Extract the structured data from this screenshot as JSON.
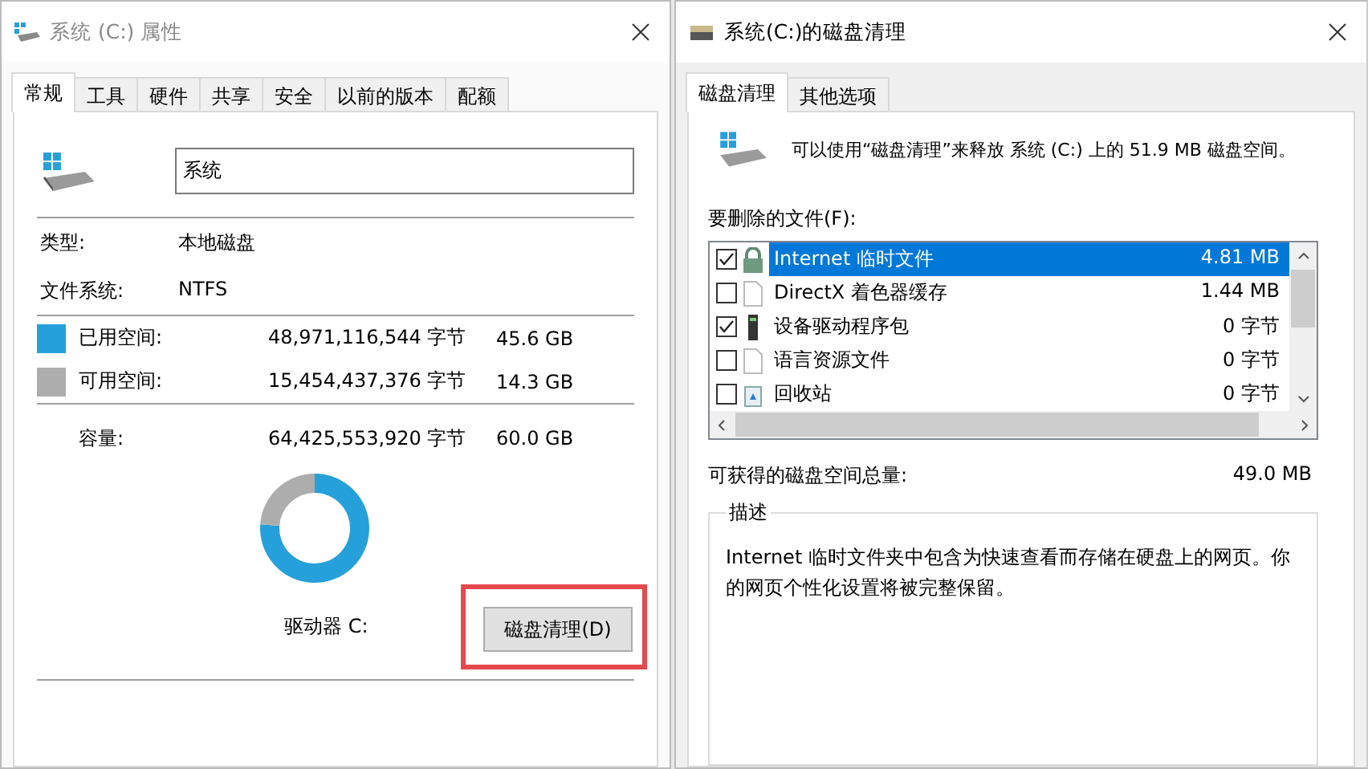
{
  "left_window": {
    "title": "系统 (C:) 属性",
    "active": false,
    "tabs": [
      {
        "label": "常规",
        "selected": true
      },
      {
        "label": "工具",
        "selected": false
      },
      {
        "label": "硬件",
        "selected": false
      },
      {
        "label": "共享",
        "selected": false
      },
      {
        "label": "安全",
        "selected": false
      },
      {
        "label": "以前的版本",
        "selected": false
      },
      {
        "label": "配额",
        "selected": false
      }
    ],
    "name_field": {
      "value": "系统"
    },
    "properties": [
      {
        "label": "类型:",
        "value": "本地磁盘"
      },
      {
        "label": "文件系统:",
        "value": "NTFS"
      }
    ],
    "space_rows": [
      {
        "label": "已用空间:",
        "bytes": "48,971,116,544 字节",
        "size": "45.6 GB",
        "color": "#26a0da"
      },
      {
        "label": "可用空间:",
        "bytes": "15,454,437,376 字节",
        "size": "14.3 GB",
        "color": "#adadad"
      }
    ],
    "capacity": {
      "label": "容量:",
      "bytes": "64,425,553,920 字节",
      "size": "60.0 GB"
    },
    "chart_data": {
      "type": "donut",
      "values": [
        76.1,
        23.9
      ]
    },
    "drive_label": "驱动器 C:",
    "cleanup_button": {
      "label": "磁盘清理(D)",
      "highlighted": true
    }
  },
  "right_window": {
    "title": "系统(C:)的磁盘清理",
    "active": true,
    "tabs": [
      {
        "label": "磁盘清理",
        "selected": true
      },
      {
        "label": "其他选项",
        "selected": false
      }
    ],
    "summary": "可以使用“磁盘清理”来释放 系统 (C:) 上的 51.9 MB 磁盘空间。",
    "files_label": "要删除的文件(F):",
    "files": [
      {
        "name": "Internet 临时文件",
        "size": "4.81 MB",
        "checked": true,
        "selected": true,
        "kind": "lock"
      },
      {
        "name": "DirectX 着色器缓存",
        "size": "1.44 MB",
        "checked": false,
        "selected": false,
        "kind": "document"
      },
      {
        "name": "设备驱动程序包",
        "size": "0 字节",
        "checked": true,
        "selected": false,
        "kind": "device"
      },
      {
        "name": "语言资源文件",
        "size": "0 字节",
        "checked": false,
        "selected": false,
        "kind": "document"
      },
      {
        "name": "回收站",
        "size": "0 字节",
        "checked": false,
        "selected": false,
        "kind": "recycle"
      }
    ],
    "total_label": "可获得的磁盘空间总量:",
    "total": "49.0 MB",
    "description": {
      "legend": "描述",
      "text": "Internet 临时文件夹中包含为快速查看而存储在硬盘上的网页。你的网页个性化设置将被完整保留。"
    }
  }
}
